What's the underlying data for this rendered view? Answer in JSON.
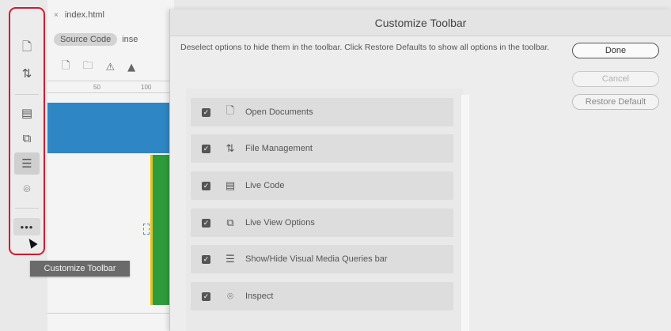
{
  "left_toolbar": {
    "icons": [
      {
        "name": "open-documents-icon",
        "glyph": "🗋"
      },
      {
        "name": "file-management-icon",
        "glyph": "⇅"
      },
      {
        "name": "live-code-icon",
        "glyph": "▤"
      },
      {
        "name": "live-view-options-icon",
        "glyph": "⧉"
      },
      {
        "name": "media-queries-icon",
        "glyph": "☰"
      },
      {
        "name": "inspect-icon",
        "glyph": "⌾"
      }
    ],
    "more_label": "•••",
    "tooltip": "Customize Toolbar"
  },
  "editor": {
    "tab_close": "×",
    "tab_label": "index.html",
    "subtab_active": "Source Code",
    "subtab_next": "inse",
    "doc_icons": [
      "🗋",
      "🗀",
      "⚠",
      "▲"
    ],
    "ruler_ticks": [
      "50",
      "100"
    ]
  },
  "dialog": {
    "title": "Customize Toolbar",
    "description": "Deselect options to hide them in the toolbar. Click Restore Defaults to show all options in the toolbar.",
    "buttons": {
      "done": "Done",
      "cancel": "Cancel",
      "restore": "Restore Default"
    },
    "options": [
      {
        "label": "Open Documents",
        "icon": "🗋",
        "checked": true
      },
      {
        "label": "File Management",
        "icon": "⇅",
        "checked": true
      },
      {
        "label": "Live Code",
        "icon": "▤",
        "checked": true
      },
      {
        "label": "Live View Options",
        "icon": "⧉",
        "checked": true
      },
      {
        "label": "Show/Hide Visual Media Queries bar",
        "icon": "☰",
        "checked": true
      },
      {
        "label": "Inspect",
        "icon": "⌾",
        "checked": true
      }
    ]
  },
  "colors": {
    "highlight_border": "#d6182e",
    "design_blue": "#2f86c4",
    "design_green": "#2e9b3b"
  }
}
